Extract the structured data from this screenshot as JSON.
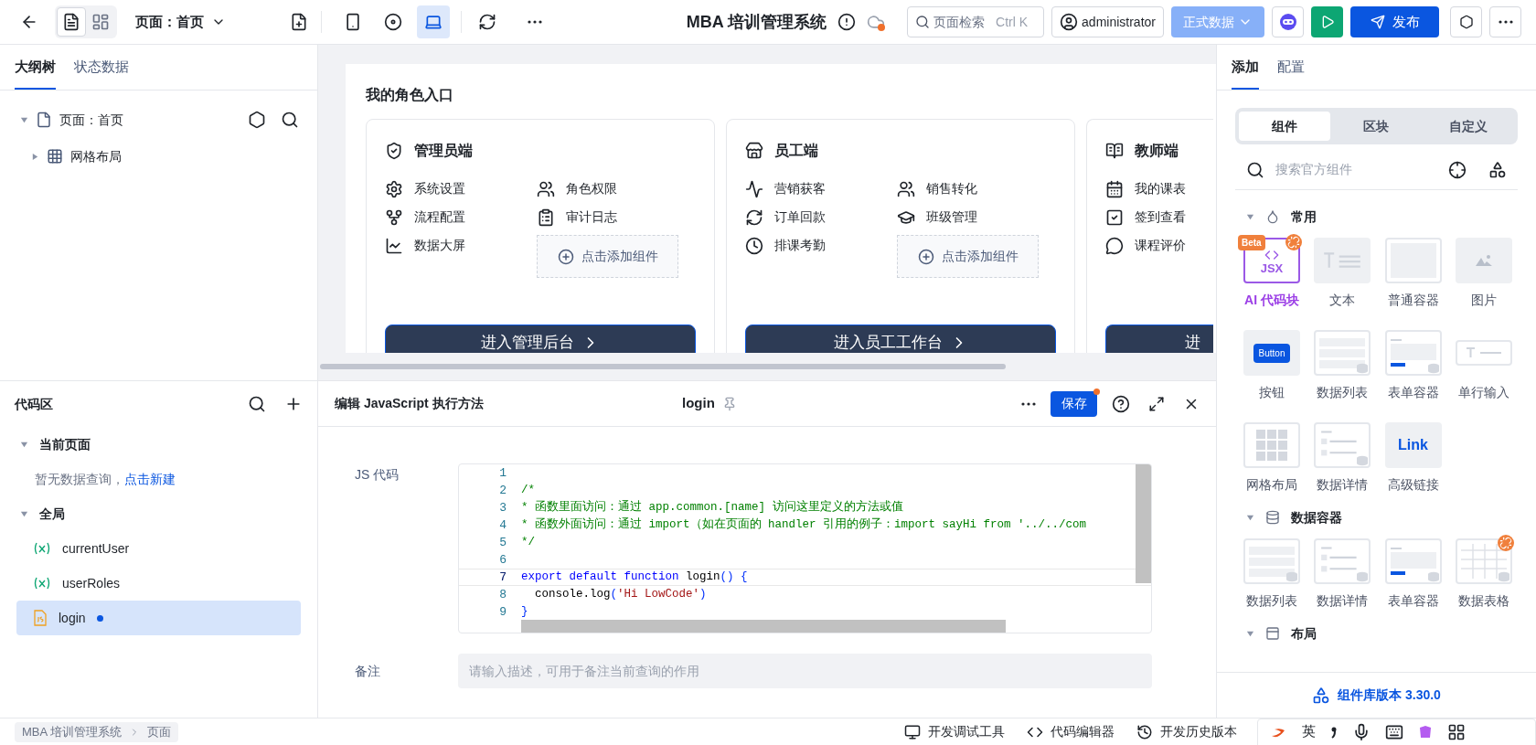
{
  "topbar": {
    "view_modes": [
      {
        "kind": "outline",
        "selected": true
      },
      {
        "kind": "layout",
        "selected": false
      }
    ],
    "page_selector": "页面：首页",
    "devices": [
      {
        "kind": "mobile",
        "selected": false
      },
      {
        "kind": "miniapp",
        "selected": false
      },
      {
        "kind": "desktop",
        "selected": true
      }
    ],
    "app_title": "MBA 培训管理系统",
    "cloud_unsynced": true,
    "search": {
      "placeholder": "页面检索",
      "shortcut": "Ctrl K"
    },
    "user": "administrator",
    "data_env": "正式数据",
    "publish": "发布"
  },
  "left_tabs": [
    {
      "label": "大纲树",
      "selected": true
    },
    {
      "label": "状态数据",
      "selected": false
    }
  ],
  "outline": [
    {
      "label": "页面：首页",
      "kind": "page",
      "expanded": true,
      "children": [
        {
          "label": "网格布局",
          "kind": "grid",
          "expanded": false
        }
      ]
    }
  ],
  "code_panel": {
    "title": "代码区",
    "sections": [
      {
        "label": "当前页面",
        "expanded": true,
        "empty_text": "暂无数据查询，",
        "empty_link": "点击新建"
      },
      {
        "label": "全局",
        "expanded": true,
        "items": [
          {
            "kind": "variable",
            "label": "currentUser",
            "selected": false,
            "modified": false
          },
          {
            "kind": "variable",
            "label": "userRoles",
            "selected": false,
            "modified": false
          },
          {
            "kind": "function",
            "label": "login",
            "selected": true,
            "modified": true
          }
        ]
      }
    ]
  },
  "canvas": {
    "section_title": "我的角色入口",
    "cards": [
      {
        "title": "管理员端",
        "kind": "shield",
        "cut_off": false,
        "columns": [
          [
            {
              "label": "系统设置",
              "kind": "gear"
            },
            {
              "label": "流程配置",
              "kind": "fork"
            },
            {
              "label": "数据大屏",
              "kind": "chart"
            }
          ],
          [
            {
              "label": "角色权限",
              "kind": "users"
            },
            {
              "label": "审计日志",
              "kind": "clipboard"
            }
          ]
        ],
        "add_label": "点击添加组件",
        "button": "进入管理后台"
      },
      {
        "title": "员工端",
        "kind": "store",
        "cut_off": false,
        "columns": [
          [
            {
              "label": "营销获客",
              "kind": "pulse"
            },
            {
              "label": "订单回款",
              "kind": "refresh"
            },
            {
              "label": "排课考勤",
              "kind": "clock"
            }
          ],
          [
            {
              "label": "销售转化",
              "kind": "users"
            },
            {
              "label": "班级管理",
              "kind": "cap"
            }
          ]
        ],
        "add_label": "点击添加组件",
        "button": "进入员工工作台"
      },
      {
        "title": "教师端",
        "kind": "book",
        "cut_off": true,
        "columns": [
          [
            {
              "label": "我的课表",
              "kind": "calendar"
            },
            {
              "label": "签到查看",
              "kind": "check"
            },
            {
              "label": "课程评价",
              "kind": "chat"
            }
          ]
        ],
        "button": "进"
      }
    ]
  },
  "editor": {
    "title": "编辑 JavaScript 执行方法",
    "method": "login",
    "save": "保存",
    "unsaved": true,
    "code_label": "JS 代码",
    "lines": [
      {
        "no": "1",
        "current": false
      },
      {
        "no": "2",
        "current": false,
        "tokens": [
          {
            "kind": "comment",
            "text": "/*"
          }
        ]
      },
      {
        "no": "3",
        "current": false,
        "tokens": [
          {
            "kind": "comment",
            "text": "* 函数里面访问：通过 app.common.[name] 访问这里定义的方法或值"
          }
        ]
      },
      {
        "no": "4",
        "current": false,
        "tokens": [
          {
            "kind": "comment",
            "text": "* 函数外面访问：通过 import（如在页面的 handler 引用的例子：import sayHi from '../../com"
          }
        ]
      },
      {
        "no": "5",
        "current": false,
        "tokens": [
          {
            "kind": "comment",
            "text": "*/"
          }
        ]
      },
      {
        "no": "6",
        "current": false
      },
      {
        "no": "7",
        "current": true,
        "tokens": [
          {
            "kind": "keyword",
            "text": "export default function "
          },
          {
            "kind": "plain",
            "text": "login"
          },
          {
            "kind": "bracket",
            "text": "() {"
          }
        ]
      },
      {
        "no": "8",
        "current": false,
        "tokens": [
          {
            "kind": "plain",
            "text": "  console.log"
          },
          {
            "kind": "bracket",
            "text": "("
          },
          {
            "kind": "string",
            "text": "'Hi LowCode'"
          },
          {
            "kind": "bracket",
            "text": ")"
          }
        ]
      },
      {
        "no": "9",
        "current": false,
        "tokens": [
          {
            "kind": "bracket",
            "text": "}"
          }
        ]
      }
    ],
    "note": {
      "label": "备注",
      "placeholder": "请输入描述，可用于备注当前查询的作用"
    }
  },
  "right_tabs": [
    {
      "label": "添加",
      "selected": true
    },
    {
      "label": "配置",
      "selected": false
    }
  ],
  "segments": [
    {
      "label": "组件",
      "selected": true
    },
    {
      "label": "区块",
      "selected": false
    },
    {
      "label": "自定义",
      "selected": false
    }
  ],
  "component_search": {
    "placeholder": "搜索官方组件"
  },
  "groups": [
    {
      "title": "常用",
      "kind": "drop",
      "expanded": true,
      "items": [
        {
          "label": "AI 代码块",
          "kind": "jsx",
          "tile_text": "JSX",
          "badge": "Beta",
          "flagged": true
        },
        {
          "label": "文本",
          "kind": "text",
          "flagged": false
        },
        {
          "label": "普通容器",
          "kind": "container",
          "flagged": false
        },
        {
          "label": "图片",
          "kind": "image",
          "flagged": false
        },
        {
          "label": "按钮",
          "kind": "button",
          "tile_text": "Button",
          "flagged": false
        },
        {
          "label": "数据列表",
          "kind": "list",
          "flagged": false
        },
        {
          "label": "表单容器",
          "kind": "form",
          "flagged": false
        },
        {
          "label": "单行输入",
          "kind": "input",
          "flagged": false
        },
        {
          "label": "网格布局",
          "kind": "grid",
          "flagged": false
        },
        {
          "label": "数据详情",
          "kind": "detail",
          "flagged": false
        },
        {
          "label": "高级链接",
          "kind": "link",
          "tile_text": "Link",
          "flagged": false
        }
      ]
    },
    {
      "title": "数据容器",
      "kind": "db",
      "expanded": true,
      "items": [
        {
          "label": "数据列表",
          "kind": "list",
          "flagged": false
        },
        {
          "label": "数据详情",
          "kind": "detail",
          "flagged": false
        },
        {
          "label": "表单容器",
          "kind": "form",
          "flagged": false
        },
        {
          "label": "数据表格",
          "kind": "table",
          "flagged": true
        }
      ]
    },
    {
      "title": "布局",
      "kind": "layout",
      "expanded": true
    }
  ],
  "library_version": "组件库版本 3.30.0",
  "status_bar": {
    "breadcrumb": [
      "MBA 培训管理系统",
      "页面"
    ],
    "tools": [
      {
        "kind": "debug",
        "label": "开发调试工具"
      },
      {
        "kind": "code",
        "label": "代码编辑器"
      },
      {
        "kind": "history",
        "label": "开发历史版本"
      }
    ],
    "ime_mode": "英"
  }
}
